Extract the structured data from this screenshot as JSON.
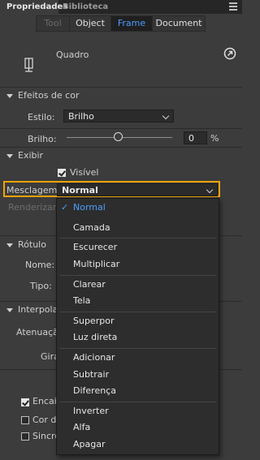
{
  "panel_tabs": [
    {
      "label": "Propriedades"
    },
    {
      "label": "Biblioteca"
    }
  ],
  "segments": [
    {
      "label": "Tool"
    },
    {
      "label": "Object"
    },
    {
      "label": "Frame"
    },
    {
      "label": "Document"
    }
  ],
  "frame": {
    "label": "Quadro"
  },
  "color_effect": {
    "header": "Efeitos de cor",
    "style_label": "Estilo:",
    "style_value": "Brilho",
    "brightness_label": "Brilho:",
    "brightness_value": "0",
    "brightness_unit": "%"
  },
  "display": {
    "header": "Exibir",
    "visible_label": "Visível",
    "visible_checked": true,
    "blend_label": "Mesclagem:",
    "blend_value": "Normal",
    "render_label": "Renderizar:"
  },
  "label_section": {
    "header": "Rótulo",
    "name_label": "Nome:",
    "type_label": "Tipo:"
  },
  "tween": {
    "header": "Interpolação",
    "ease_label": "Atenuação",
    "rotate_label": "Girar"
  },
  "checkboxes": [
    {
      "label": "Encaixar"
    },
    {
      "label": "Cor do"
    },
    {
      "label": "Sincro"
    }
  ],
  "blend_menu": {
    "groups": [
      [
        {
          "label": "Normal",
          "checkmark": "✓"
        },
        {
          "label": "Camada"
        }
      ],
      [
        {
          "label": "Escurecer"
        },
        {
          "label": "Multiplicar"
        }
      ],
      [
        {
          "label": "Clarear"
        },
        {
          "label": "Tela"
        }
      ],
      [
        {
          "label": "Superpor"
        },
        {
          "label": "Luz direta"
        }
      ],
      [
        {
          "label": "Adicionar"
        },
        {
          "label": "Subtrair"
        },
        {
          "label": "Diferença"
        }
      ],
      [
        {
          "label": "Inverter"
        },
        {
          "label": "Alfa"
        },
        {
          "label": "Apagar"
        }
      ]
    ]
  },
  "colors": {
    "highlight": "#f0a30a",
    "selected_text": "#4a9eff"
  }
}
